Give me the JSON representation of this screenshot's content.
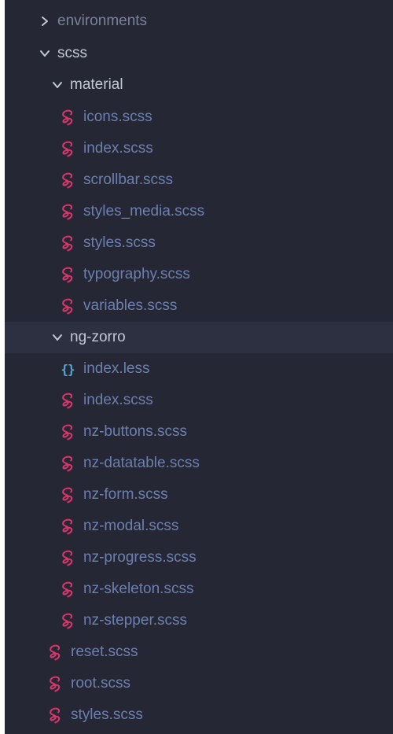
{
  "colors": {
    "panel_bg": "#252834",
    "selected_bg": "#2d3040",
    "sass_icon": "#d8346a",
    "less_icon": "#4fa8d6",
    "folder_text": "#c2c7d6",
    "file_text": "#6e7fae"
  },
  "tree": {
    "environments": {
      "label": "environments",
      "icon": "chevron-right-icon",
      "expanded": false
    },
    "scss": {
      "label": "scss",
      "icon": "chevron-down-icon",
      "expanded": true
    },
    "material": {
      "label": "material",
      "icon": "chevron-down-icon",
      "expanded": true,
      "files": [
        {
          "label": "icons.scss",
          "icon": "sass-icon"
        },
        {
          "label": "index.scss",
          "icon": "sass-icon"
        },
        {
          "label": "scrollbar.scss",
          "icon": "sass-icon"
        },
        {
          "label": "styles_media.scss",
          "icon": "sass-icon"
        },
        {
          "label": "styles.scss",
          "icon": "sass-icon"
        },
        {
          "label": "typography.scss",
          "icon": "sass-icon"
        },
        {
          "label": "variables.scss",
          "icon": "sass-icon"
        }
      ]
    },
    "ng_zorro": {
      "label": "ng-zorro",
      "icon": "chevron-down-icon",
      "expanded": true,
      "selected": true,
      "files": [
        {
          "label": "index.less",
          "icon": "less-braces-icon",
          "glyph": "{}"
        },
        {
          "label": "index.scss",
          "icon": "sass-icon"
        },
        {
          "label": "nz-buttons.scss",
          "icon": "sass-icon"
        },
        {
          "label": "nz-datatable.scss",
          "icon": "sass-icon"
        },
        {
          "label": "nz-form.scss",
          "icon": "sass-icon"
        },
        {
          "label": "nz-modal.scss",
          "icon": "sass-icon"
        },
        {
          "label": "nz-progress.scss",
          "icon": "sass-icon"
        },
        {
          "label": "nz-skeleton.scss",
          "icon": "sass-icon"
        },
        {
          "label": "nz-stepper.scss",
          "icon": "sass-icon"
        }
      ]
    },
    "scss_files": [
      {
        "label": "reset.scss",
        "icon": "sass-icon"
      },
      {
        "label": "root.scss",
        "icon": "sass-icon"
      },
      {
        "label": "styles.scss",
        "icon": "sass-icon"
      }
    ]
  }
}
